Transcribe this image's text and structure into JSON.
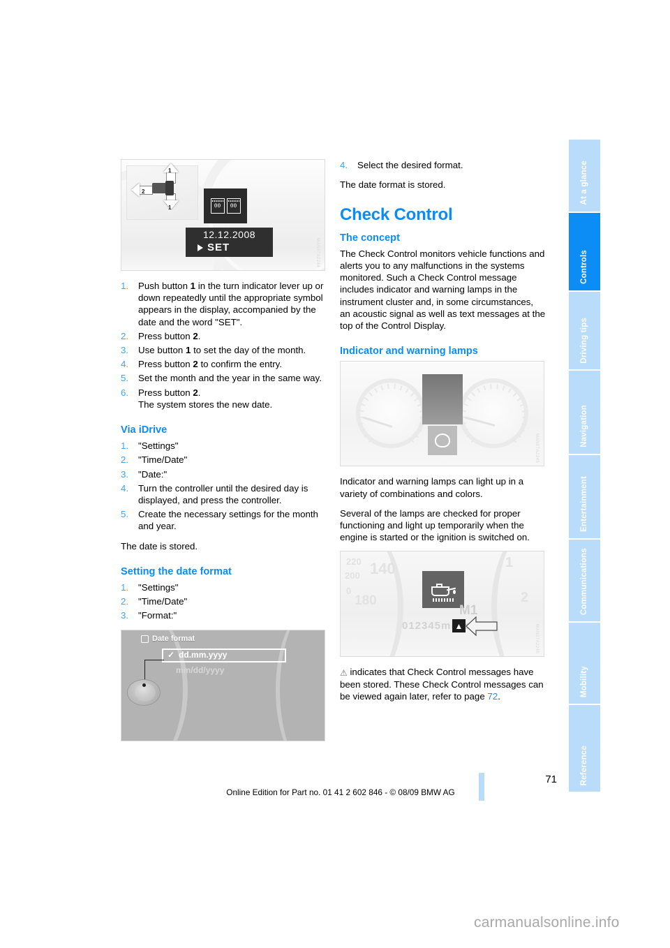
{
  "page": {
    "number": "71",
    "edition": "Online Edition for Part no. 01 41 2 602 846 - © 08/09 BMW AG",
    "watermark": "carmanualsonline.info"
  },
  "sidebar": {
    "tabs": [
      {
        "label": "At a glance",
        "active": false
      },
      {
        "label": "Controls",
        "active": true
      },
      {
        "label": "Driving tips",
        "active": false
      },
      {
        "label": "Navigation",
        "active": false
      },
      {
        "label": "Entertainment",
        "active": false
      },
      {
        "label": "Communications",
        "active": false
      },
      {
        "label": "Mobility",
        "active": false
      },
      {
        "label": "Reference",
        "active": false
      }
    ]
  },
  "left_column": {
    "figure_lever": {
      "code": "MAN07A2244",
      "label_1_top": "1",
      "label_1_bottom": "1",
      "label_2": "2",
      "display_date": "12.12.2008",
      "display_set": "SET",
      "calendar_left": "00",
      "calendar_right": "00"
    },
    "steps_manual": [
      {
        "num": "1.",
        "text": "Push button 1 in the turn indicator lever up or down repeatedly until the appropriate symbol appears in the display, accompanied by the date and the word \"SET\"."
      },
      {
        "num": "2.",
        "text": "Press button 2."
      },
      {
        "num": "3.",
        "text": "Use button 1 to set the day of the month."
      },
      {
        "num": "4.",
        "text": "Press button 2 to confirm the entry."
      },
      {
        "num": "5.",
        "text": "Set the month and the year in the same way."
      },
      {
        "num": "6.",
        "text": "Press button 2.\nThe system stores the new date."
      }
    ],
    "via_idrive_heading": "Via iDrive",
    "steps_idrive": [
      {
        "num": "1.",
        "text": "\"Settings\""
      },
      {
        "num": "2.",
        "text": "\"Time/Date\""
      },
      {
        "num": "3.",
        "text": "\"Date:\""
      },
      {
        "num": "4.",
        "text": "Turn the controller until the desired day is displayed, and press the controller."
      },
      {
        "num": "5.",
        "text": "Create the necessary settings for the month and year."
      }
    ],
    "date_stored": "The date is stored.",
    "date_format_heading": "Setting the date format",
    "steps_format": [
      {
        "num": "1.",
        "text": "\"Settings\""
      },
      {
        "num": "2.",
        "text": "\"Time/Date\""
      },
      {
        "num": "3.",
        "text": "\"Format:\""
      }
    ],
    "figure_format": {
      "title": "Date format",
      "option_selected": "dd.mm.yyyy",
      "option_other": "mm/dd/yyyy",
      "check": "✓"
    }
  },
  "right_column": {
    "step4": {
      "num": "4.",
      "text": "Select the desired format."
    },
    "format_stored": "The date format is stored.",
    "chapter_title": "Check Control",
    "concept_heading": "The concept",
    "concept_text": "The Check Control monitors vehicle functions and alerts you to any malfunctions in the systems monitored. Such a Check Control message includes indicator and warning lamps in the instrument cluster and, in some circumstances, an acoustic signal as well as text messages at the top of the Control Display.",
    "lamps_heading": "Indicator and warning lamps",
    "figure_cluster": {
      "code": "MAN07A2245"
    },
    "lamps_text_1": "Indicator and warning lamps can light up in a variety of combinations and colors.",
    "lamps_text_2": "Several of the lamps are checked for proper functioning and light up temporarily when the engine is started or the ignition is switched on.",
    "figure_oil": {
      "code": "MAN07A2246",
      "odometer": "012345miles",
      "gear": "M1",
      "tick_labels": [
        "220",
        "200",
        "0",
        "180",
        "140",
        "1",
        "2"
      ]
    },
    "stored_note_prefix": " indicates that Check Control messages have been stored. These Check Control messages can be viewed again later, refer to page ",
    "stored_note_link": "72",
    "stored_note_suffix": ".",
    "warning_glyph": "⚠"
  }
}
